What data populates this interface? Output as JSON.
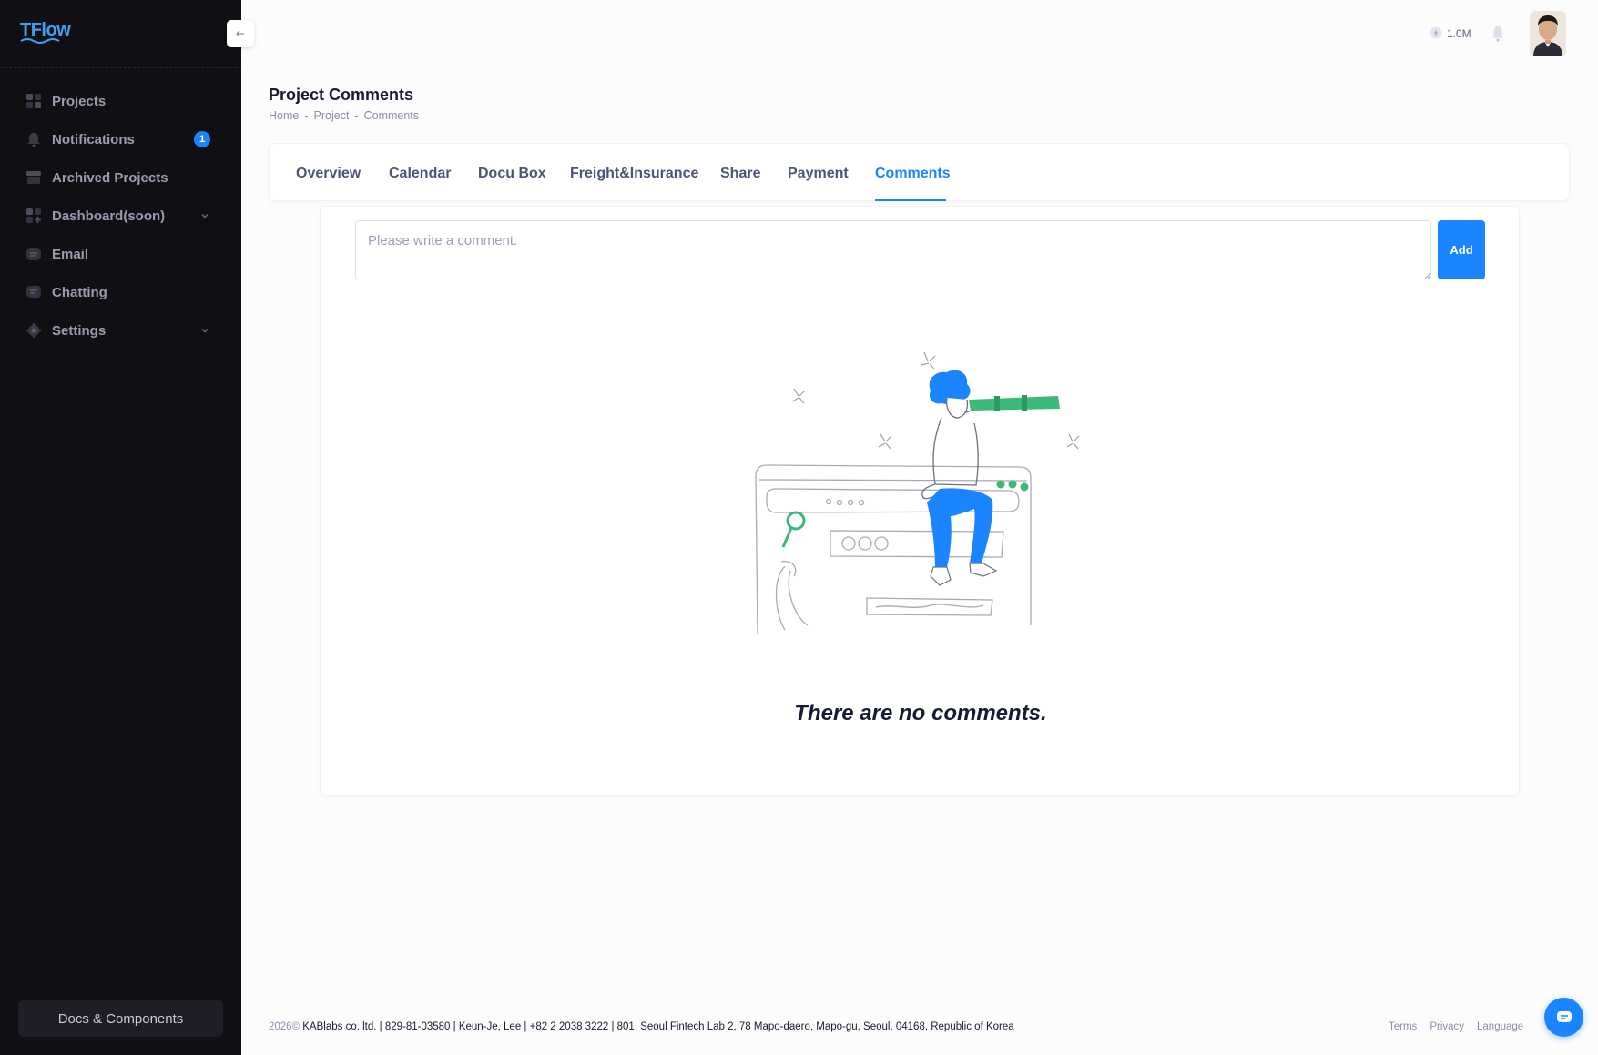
{
  "app": {
    "logo": "TFlow"
  },
  "sidebar": {
    "collapse_icon": "arrow-left-icon",
    "items": [
      {
        "label": "Projects",
        "icon": "grid-icon"
      },
      {
        "label": "Notifications",
        "icon": "bell-icon",
        "badge": "1"
      },
      {
        "label": "Archived Projects",
        "icon": "archive-icon"
      },
      {
        "label": "Dashboard(soon)",
        "icon": "dashboard-icon",
        "has_submenu": true
      },
      {
        "label": "Email",
        "icon": "message-icon"
      },
      {
        "label": "Chatting",
        "icon": "chat-icon"
      },
      {
        "label": "Settings",
        "icon": "gear-icon",
        "has_submenu": true
      }
    ],
    "docs_label": "Docs & Components"
  },
  "header": {
    "coin_value": "1.0M",
    "coin_icon": "coin-icon",
    "bell_icon": "bell-icon",
    "avatar": "user-avatar"
  },
  "page": {
    "title": "Project Comments",
    "breadcrumb": [
      "Home",
      "Project",
      "Comments"
    ],
    "breadcrumb_sep": "-"
  },
  "tabs": [
    {
      "label": "Overview",
      "active": false
    },
    {
      "label": "Calendar",
      "active": false
    },
    {
      "label": "Docu Box",
      "active": false
    },
    {
      "label": "Freight&Insurance",
      "active": false
    },
    {
      "label": "Share",
      "active": false
    },
    {
      "label": "Payment",
      "active": false
    },
    {
      "label": "Comments",
      "active": true
    }
  ],
  "comments": {
    "placeholder": "Please write a comment.",
    "value": "",
    "add_label": "Add",
    "empty_message": "There are no comments.",
    "illustration": "person-with-telescope-illustration"
  },
  "footer": {
    "year": "2026©",
    "company": "KABlabs co.,ltd. | 829-81-03580 | Keun-Je, Lee | +82 2 2038 3222 | 801, Seoul Fintech Lab 2, 78 Mapo-daero, Mapo-gu, Seoul, 04168, Republic of Korea",
    "links": [
      "Terms",
      "Privacy",
      "Language"
    ]
  },
  "colors": {
    "accent": "#1b84ff",
    "sidebar_bg": "#101014",
    "illustration_blue": "#1b84ff",
    "illustration_green": "#3cb878"
  }
}
